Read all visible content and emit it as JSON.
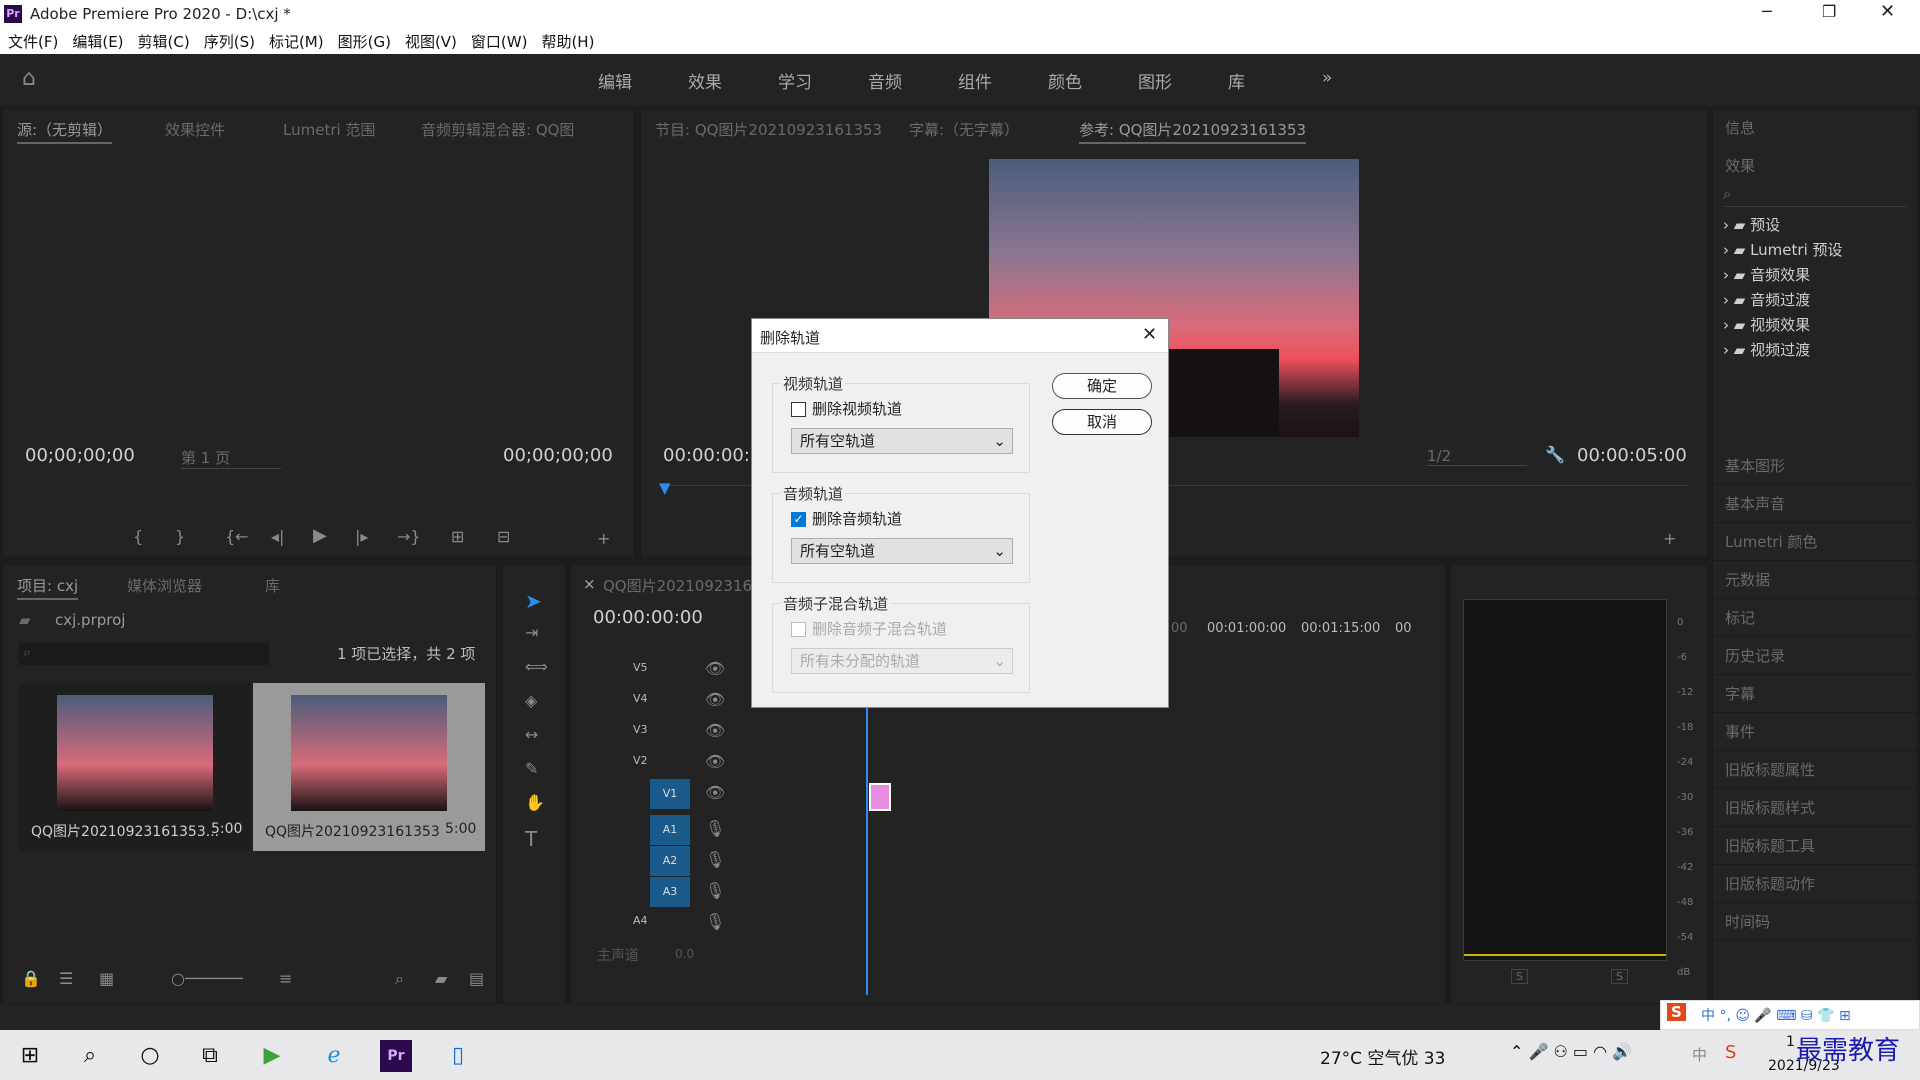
{
  "app": {
    "title": "Adobe Premiere Pro 2020 - D:\\cxj *",
    "logo": "Pr"
  },
  "menu": [
    "文件(F)",
    "编辑(E)",
    "剪辑(C)",
    "序列(S)",
    "标记(M)",
    "图形(G)",
    "视图(V)",
    "窗口(W)",
    "帮助(H)"
  ],
  "workspaces": [
    "编辑",
    "效果",
    "学习",
    "音频",
    "组件",
    "颜色",
    "图形",
    "库"
  ],
  "source": {
    "tabs": [
      "源:（无剪辑）",
      "效果控件",
      "Lumetri 范围",
      "音频剪辑混合器: QQ图"
    ],
    "tc_left": "00;00;00;00",
    "tc_right": "00;00;00;00",
    "page": "第 1 页"
  },
  "program": {
    "tabs": [
      "节目: QQ图片20210923161353",
      "字幕:（无字幕）",
      "参考: QQ图片20210923161353"
    ],
    "tc_left": "00:00:00:0",
    "tc_right": "00:00:05:00",
    "scale": "1/2"
  },
  "right_panels": {
    "info": "信息",
    "effects": "效果",
    "items": [
      "基本图形",
      "基本声音",
      "Lumetri 颜色",
      "元数据",
      "标记",
      "历史记录",
      "字幕",
      "事件",
      "旧版标题属性",
      "旧版标题样式",
      "旧版标题工具",
      "旧版标题动作",
      "时间码"
    ]
  },
  "effects_tree": [
    "预设",
    "Lumetri 预设",
    "音频效果",
    "音频过渡",
    "视频效果",
    "视频过渡"
  ],
  "project": {
    "tabs": [
      "项目: cxj",
      "媒体浏览器",
      "库"
    ],
    "file": "cxj.prproj",
    "status": "1 项已选择，共 2 项",
    "items": [
      {
        "name": "QQ图片20210923161353...",
        "dur": "5:00"
      },
      {
        "name": "QQ图片20210923161353",
        "dur": "5:00"
      }
    ]
  },
  "timeline": {
    "tab": "QQ图片2021092316135",
    "tc": "00:00:00:00",
    "ruler": [
      "00",
      "00:01:00:00",
      "00:01:15:00",
      "00"
    ],
    "video_tracks": [
      "V5",
      "V4",
      "V3",
      "V2",
      "V1"
    ],
    "audio_tracks": [
      "A1",
      "A2",
      "A3",
      "A4"
    ],
    "master": "主声道",
    "master_val": "0.0"
  },
  "meter": {
    "scale": [
      "0",
      "-6",
      "-12",
      "-18",
      "-24",
      "-30",
      "-36",
      "-42",
      "-48",
      "-54",
      "dB"
    ],
    "s": [
      "S",
      "S"
    ]
  },
  "dialog": {
    "title": "删除轨道",
    "ok": "确定",
    "cancel": "取消",
    "video": {
      "label": "视频轨道",
      "check": "删除视频轨道",
      "checked": false,
      "select": "所有空轨道"
    },
    "audio": {
      "label": "音频轨道",
      "check": "删除音频轨道",
      "checked": true,
      "select": "所有空轨道"
    },
    "submix": {
      "label": "音频子混合轨道",
      "check": "删除音频子混合轨道",
      "checked": false,
      "select": "所有未分配的轨道"
    }
  },
  "taskbar": {
    "weather": "27°C 空气优 33",
    "ime": "中",
    "date": "2021/9/23",
    "time": "1",
    "watermark": "最需教育"
  }
}
